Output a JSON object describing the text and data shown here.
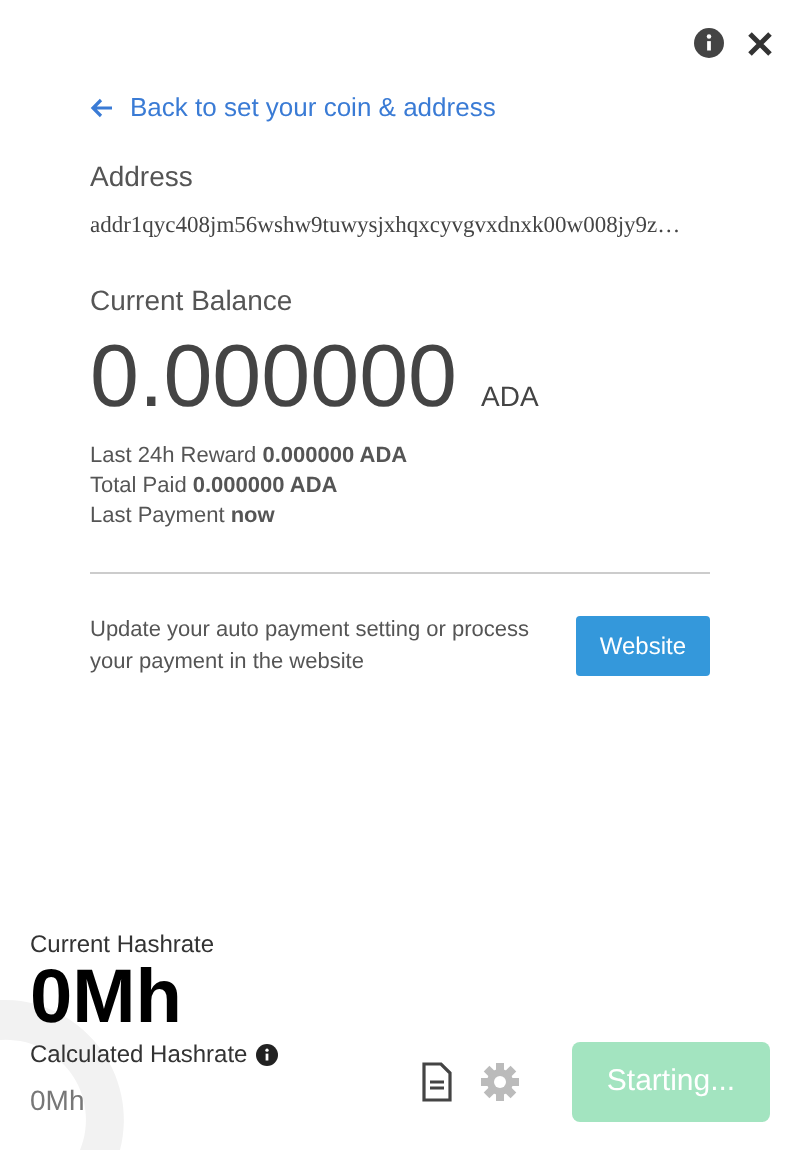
{
  "back_link": "Back to set your coin & address",
  "address": {
    "label": "Address",
    "value": "addr1qyc408jm56wshw9tuwysjxhqxcyvgvxdnxk00w008jy9z…"
  },
  "balance": {
    "label": "Current Balance",
    "amount": "0.000000",
    "unit": "ADA"
  },
  "stats": [
    "Last 24h Reward **0.000000 ADA**",
    "Total Paid **0.000000 ADA**",
    "Last Payment **now**"
  ],
  "payment_note": "Update your auto payment setting or process your payment in the website",
  "website_button": "Website",
  "hashrate": {
    "label": "Current Hashrate",
    "value": "0Mh",
    "calculated_label": "Calculated Hashrate",
    "calculated_value": "0Mh"
  },
  "start_button": {
    "label": "Starting...",
    "disabled": true
  }
}
